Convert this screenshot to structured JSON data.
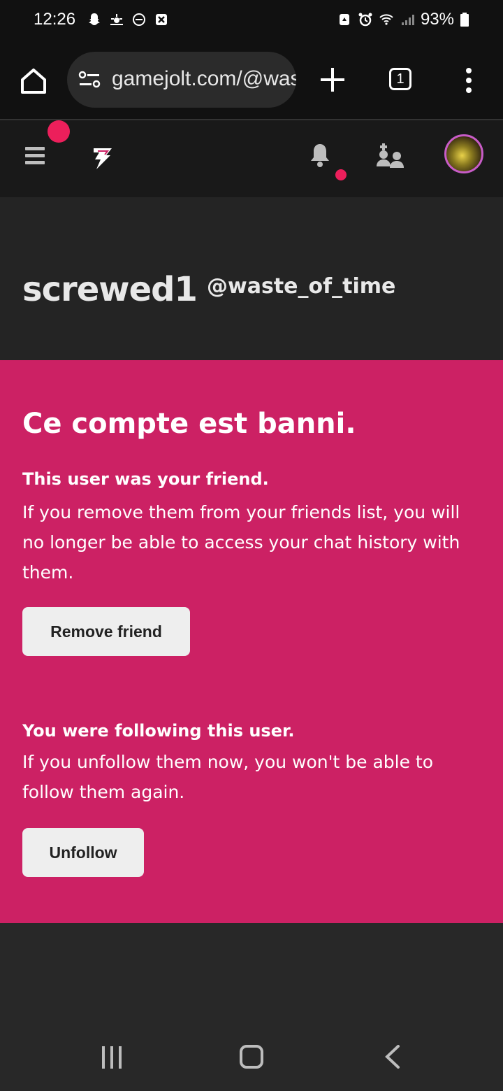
{
  "status_bar": {
    "time": "12:26",
    "battery": "93%"
  },
  "browser": {
    "url": "gamejolt.com/@waste_of_time",
    "tab_count": "1"
  },
  "profile": {
    "display_name": "screwed1",
    "username": "@waste_of_time"
  },
  "banned": {
    "title": "Ce compte est banni.",
    "friend_heading": "This user was your friend.",
    "friend_text": "If you remove them from your friends list, you will no longer be able to access your chat history with them.",
    "remove_label": "Remove friend",
    "follow_heading": "You were following this user.",
    "follow_text": "If you unfollow them now, you won't be able to follow them again.",
    "unfollow_label": "Unfollow"
  },
  "colors": {
    "accent": "#cc2164",
    "notification_dot": "#ec1f5b"
  }
}
